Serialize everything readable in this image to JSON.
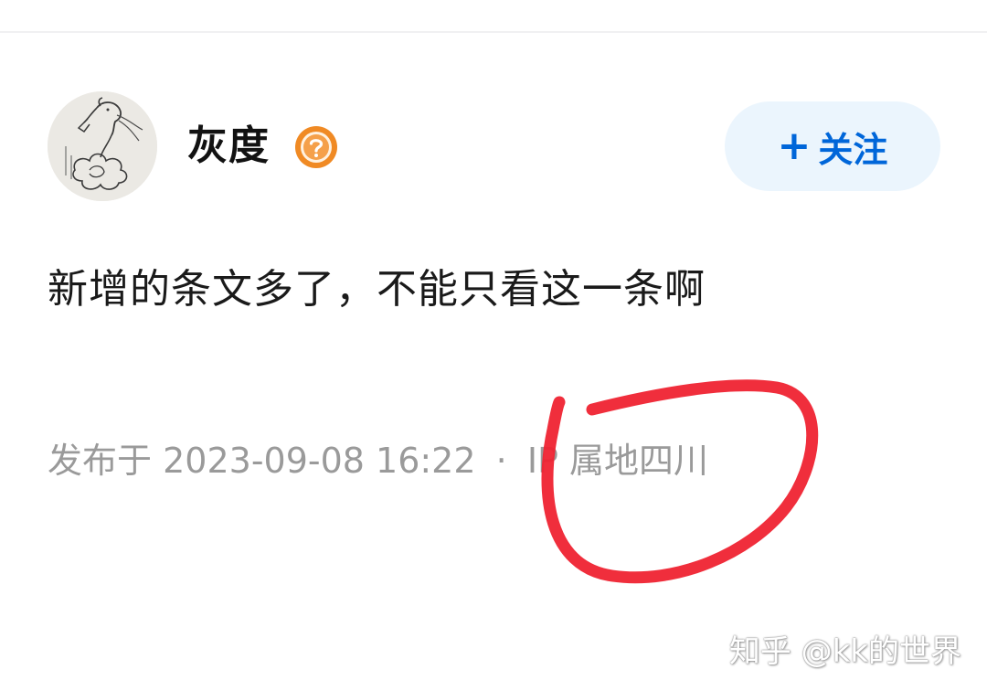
{
  "post": {
    "author": {
      "name": "灰度",
      "avatar_icon": "hand-drawn-horse-avatar",
      "badge_icon": "question-mark-badge-icon",
      "badge_color": "#f08a24"
    },
    "follow_button": {
      "plus": "+",
      "label": "关注",
      "text_color": "#0066d9",
      "background": "#ebf5fd"
    },
    "content": "新增的条文多了，不能只看这一条啊",
    "meta": {
      "published_label": "发布于",
      "datetime": "2023-09-08 16:22",
      "separator": "·",
      "ip_label": "IP",
      "location_label": "属地四川"
    }
  },
  "annotation": {
    "type": "red-hand-drawn-circle",
    "color": "#ef2332"
  },
  "watermark": {
    "text": "知乎 @kk的世界"
  }
}
